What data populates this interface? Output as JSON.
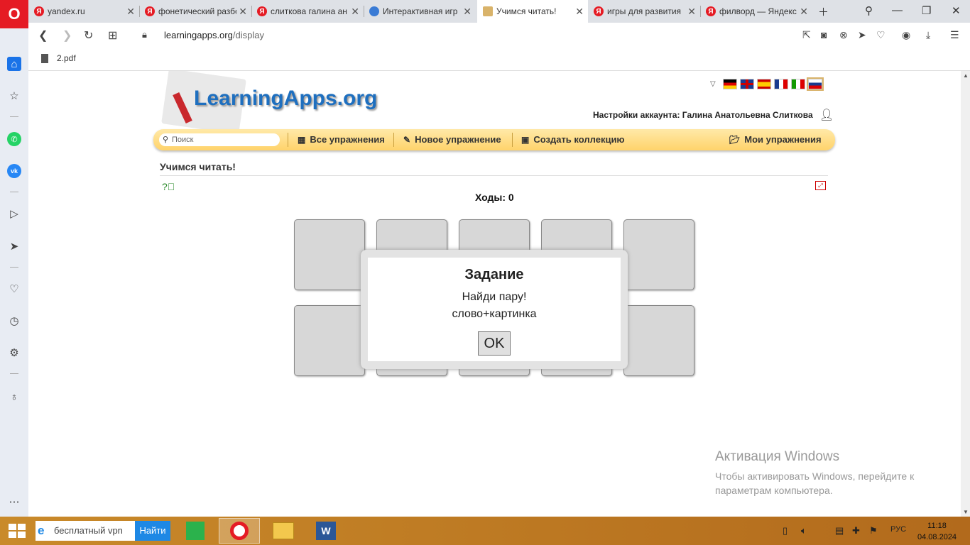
{
  "browser": {
    "tabs": [
      {
        "label": "yandex.ru",
        "icon": "yandex-icon"
      },
      {
        "label": "фонетический разбор",
        "icon": "yandex-icon"
      },
      {
        "label": "слиткова галина ан",
        "icon": "yandex-icon"
      },
      {
        "label": "Интерактивная игр",
        "icon": "globe-icon"
      },
      {
        "label": "Учимся читать!",
        "icon": "book-icon"
      },
      {
        "label": "игры для развития",
        "icon": "yandex-icon"
      },
      {
        "label": "филворд — Яндекс",
        "icon": "yandex-icon"
      }
    ],
    "url_host": "learningapps.org",
    "url_path": "/display",
    "bookmark": "2.pdf"
  },
  "site": {
    "logo": "LearningApps.org",
    "account": "Настройки аккаунта: Галина Анатольевна Слиткова",
    "search_placeholder": "Поиск",
    "menu": {
      "all": "Все упражнения",
      "new": "Новое упражнение",
      "collection": "Создать коллекцию",
      "mine": "Мои упражнения"
    },
    "flags": [
      "de",
      "gb",
      "es",
      "fr",
      "it",
      "ru"
    ]
  },
  "page": {
    "title": "Учимся читать!",
    "moves": "Ходы: 0"
  },
  "dialog": {
    "title": "Задание",
    "line1": "Найди пару!",
    "line2": "слово+картинка",
    "ok": "OK"
  },
  "windows_activation": {
    "title": "Активация Windows",
    "text": "Чтобы активировать Windows, перейдите к параметрам компьютера."
  },
  "taskbar": {
    "search_value": "бесплатный vpn",
    "search_button": "Найти",
    "lang": "РУС",
    "time": "11:18",
    "date": "04.08.2024"
  },
  "colors": {
    "accent": "#1e6fbf",
    "menubar": "#ffd36b",
    "opera_red": "#e51b24"
  }
}
